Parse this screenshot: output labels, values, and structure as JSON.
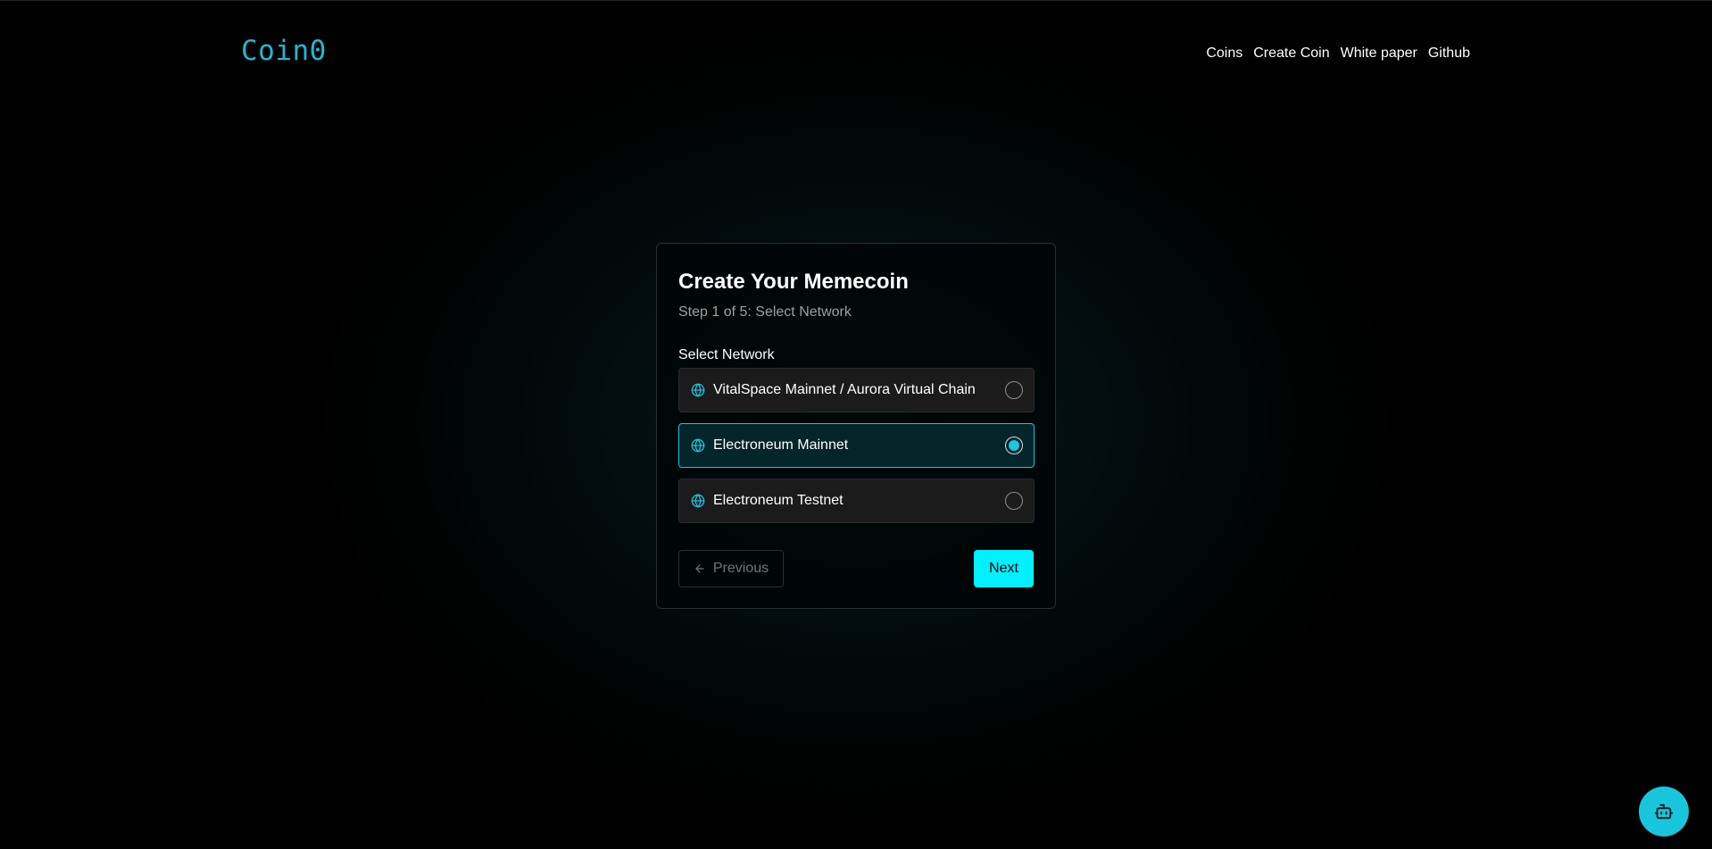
{
  "brand": {
    "logo": "Coin0",
    "accent": "#20b8d2"
  },
  "nav": {
    "items": [
      {
        "label": "Coins"
      },
      {
        "label": "Create Coin"
      },
      {
        "label": "White paper"
      },
      {
        "label": "Github"
      }
    ]
  },
  "wizard": {
    "title": "Create Your Memecoin",
    "step_text": "Step 1 of 5: Select Network",
    "field_label": "Select Network",
    "options": [
      {
        "label": "VitalSpace Mainnet / Aurora Virtual Chain",
        "icon": "globe-icon",
        "selected": false
      },
      {
        "label": "Electroneum Mainnet",
        "icon": "globe-icon",
        "selected": true
      },
      {
        "label": "Electroneum Testnet",
        "icon": "globe-icon",
        "selected": false
      }
    ],
    "previous_label": "Previous",
    "previous_icon": "arrow-left-icon",
    "next_label": "Next",
    "next_color": "#00f0ff"
  },
  "assistant": {
    "icon": "bot-icon",
    "color": "#18c6dc"
  }
}
